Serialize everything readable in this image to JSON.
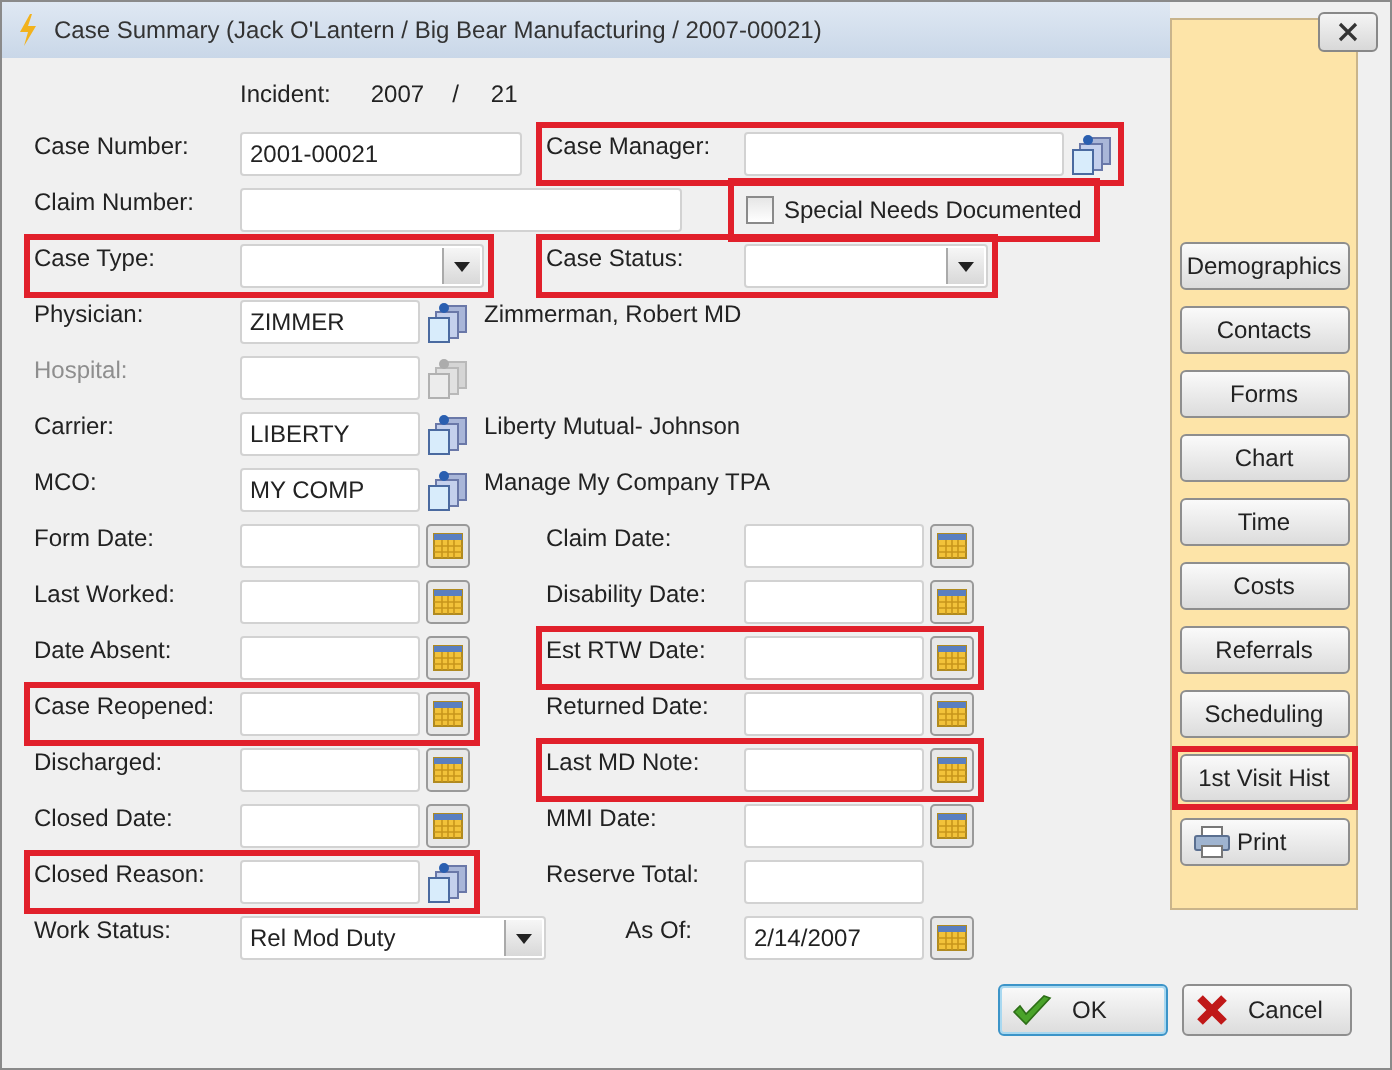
{
  "window": {
    "title": "Case Summary (Jack O'Lantern / Big Bear Manufacturing / 2007-00021)"
  },
  "incident": {
    "label": "Incident:",
    "year": "2007",
    "separator": "/",
    "number": "21"
  },
  "rows": [
    {
      "left": {
        "kind": "text",
        "label": "Case Number:",
        "value": "2001-00021",
        "highlighted": false
      },
      "right": {
        "kind": "lookup",
        "label": "Case Manager:",
        "highlighted": true,
        "disabled": false
      }
    },
    {
      "left": {
        "kind": "text",
        "label": "Claim Number:",
        "highlighted": false
      },
      "right": {
        "kind": "checkbox",
        "label": "Special Needs Documented",
        "checked": false,
        "highlighted": true
      }
    },
    {
      "left": {
        "kind": "dropdown",
        "label": "Case Type:",
        "highlighted": true
      },
      "right": {
        "kind": "dropdown",
        "label": "Case Status:",
        "highlighted": true
      }
    },
    {
      "left": {
        "kind": "lookup",
        "label": "Physician:",
        "value": "ZIMMER",
        "note": "Zimmerman, Robert  MD",
        "highlighted": false,
        "disabled": false
      }
    },
    {
      "left": {
        "kind": "lookup",
        "label": "Hospital:",
        "highlighted": false,
        "disabled": true
      }
    },
    {
      "left": {
        "kind": "lookup",
        "label": "Carrier:",
        "value": "LIBERTY",
        "note": "Liberty Mutual- Johnson",
        "highlighted": false,
        "disabled": false
      }
    },
    {
      "left": {
        "kind": "lookup",
        "label": "MCO:",
        "value": "MY COMP",
        "note": "Manage My Company TPA",
        "highlighted": false,
        "disabled": false
      }
    },
    {
      "left": {
        "kind": "date",
        "label": "Form Date:",
        "highlighted": false
      },
      "right": {
        "kind": "date",
        "label": "Claim Date:",
        "highlighted": false
      }
    },
    {
      "left": {
        "kind": "date",
        "label": "Last Worked:",
        "highlighted": false
      },
      "right": {
        "kind": "date",
        "label": "Disability Date:",
        "highlighted": false
      }
    },
    {
      "left": {
        "kind": "date",
        "label": "Date Absent:",
        "highlighted": false
      },
      "right": {
        "kind": "date",
        "label": "Est RTW Date:",
        "highlighted": true
      }
    },
    {
      "left": {
        "kind": "date",
        "label": "Case Reopened:",
        "highlighted": true
      },
      "right": {
        "kind": "date",
        "label": "Returned Date:",
        "highlighted": false
      }
    },
    {
      "left": {
        "kind": "date",
        "label": "Discharged:",
        "highlighted": false
      },
      "right": {
        "kind": "date",
        "label": "Last MD Note:",
        "highlighted": true
      }
    },
    {
      "left": {
        "kind": "date",
        "label": "Closed Date:",
        "highlighted": false
      },
      "right": {
        "kind": "date",
        "label": "MMI Date:",
        "highlighted": false
      }
    },
    {
      "left": {
        "kind": "lookup",
        "label": "Closed Reason:",
        "highlighted": true,
        "disabled": false
      },
      "right": {
        "kind": "text",
        "label": "Reserve Total:",
        "highlighted": false
      }
    },
    {
      "left": {
        "kind": "dropdown",
        "label": "Work Status:",
        "value": "Rel Mod Duty",
        "highlighted": false
      },
      "right": {
        "kind": "date",
        "label": "As Of:",
        "value": "2/14/2007",
        "highlighted": false
      }
    }
  ],
  "side_buttons": [
    {
      "kind": "plain",
      "label": "Demographics",
      "highlighted": false
    },
    {
      "kind": "plain",
      "label": "Contacts",
      "highlighted": false
    },
    {
      "kind": "plain",
      "label": "Forms",
      "highlighted": false
    },
    {
      "kind": "plain",
      "label": "Chart",
      "highlighted": false
    },
    {
      "kind": "plain",
      "label": "Time",
      "highlighted": false
    },
    {
      "kind": "plain",
      "label": "Costs",
      "highlighted": false
    },
    {
      "kind": "plain",
      "label": "Referrals",
      "highlighted": false
    },
    {
      "kind": "plain",
      "label": "Scheduling",
      "highlighted": false
    },
    {
      "kind": "plain",
      "label": "1st Visit Hist",
      "highlighted": true
    },
    {
      "kind": "print",
      "label": "Print",
      "highlighted": false
    }
  ],
  "ok_button": {
    "label": "OK",
    "focused": true
  },
  "cancel_button": {
    "label": "Cancel",
    "focused": false
  }
}
